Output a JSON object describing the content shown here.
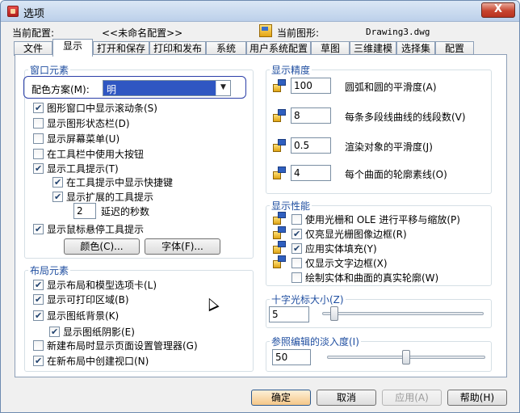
{
  "window": {
    "title": "选项",
    "close_label": "X"
  },
  "info": {
    "current_profile_label": "当前配置:",
    "current_profile_value": "<<未命名配置>>",
    "current_drawing_label": "当前图形:",
    "current_drawing_value": "Drawing3.dwg"
  },
  "tabs": [
    "文件",
    "显示",
    "打开和保存",
    "打印和发布",
    "系统",
    "用户系统配置",
    "草图",
    "三维建模",
    "选择集",
    "配置"
  ],
  "window_elements": {
    "title": "窗口元素",
    "color_scheme_label": "配色方案(M):",
    "color_scheme_value": "明",
    "options": [
      {
        "label": "图形窗口中显示滚动条(S)",
        "checked": true
      },
      {
        "label": "显示图形状态栏(D)",
        "checked": false
      },
      {
        "label": "显示屏幕菜单(U)",
        "checked": false
      },
      {
        "label": "在工具栏中使用大按钮",
        "checked": false
      },
      {
        "label": "显示工具提示(T)",
        "checked": true
      },
      {
        "label": "在工具提示中显示快捷键",
        "checked": true
      },
      {
        "label": "显示扩展的工具提示",
        "checked": true
      }
    ],
    "delay_value": "2",
    "delay_label": "延迟的秒数",
    "rollover_label": "显示鼠标悬停工具提示",
    "rollover_checked": true,
    "colors_button": "颜色(C)...",
    "fonts_button": "字体(F)..."
  },
  "layout_elements": {
    "title": "布局元素",
    "options": [
      {
        "label": "显示布局和模型选项卡(L)",
        "checked": true
      },
      {
        "label": "显示可打印区域(B)",
        "checked": true
      },
      {
        "label": "显示图纸背景(K)",
        "checked": true
      },
      {
        "label": "显示图纸阴影(E)",
        "checked": true
      },
      {
        "label": "新建布局时显示页面设置管理器(G)",
        "checked": false
      },
      {
        "label": "在新布局中创建视口(N)",
        "checked": true
      }
    ]
  },
  "display_resolution": {
    "title": "显示精度",
    "rows": [
      {
        "value": "100",
        "label": "圆弧和圆的平滑度(A)"
      },
      {
        "value": "8",
        "label": "每条多段线曲线的线段数(V)"
      },
      {
        "value": "0.5",
        "label": "渲染对象的平滑度(J)"
      },
      {
        "value": "4",
        "label": "每个曲面的轮廓素线(O)"
      }
    ]
  },
  "display_performance": {
    "title": "显示性能",
    "options": [
      {
        "label": "使用光栅和 OLE 进行平移与缩放(P)",
        "checked": false
      },
      {
        "label": "仅亮显光栅图像边框(R)",
        "checked": true
      },
      {
        "label": "应用实体填充(Y)",
        "checked": true
      },
      {
        "label": "仅显示文字边框(X)",
        "checked": false
      },
      {
        "label": "绘制实体和曲面的真实轮廓(W)",
        "checked": false
      }
    ]
  },
  "crosshair": {
    "title": "十字光标大小(Z)",
    "value": "5",
    "fraction": 0.05
  },
  "xref_fade": {
    "title": "参照编辑的淡入度(I)",
    "value": "50",
    "fraction": 0.5
  },
  "buttons": {
    "ok": "确定",
    "cancel": "取消",
    "apply": "应用(A)",
    "help": "帮助(H)"
  }
}
